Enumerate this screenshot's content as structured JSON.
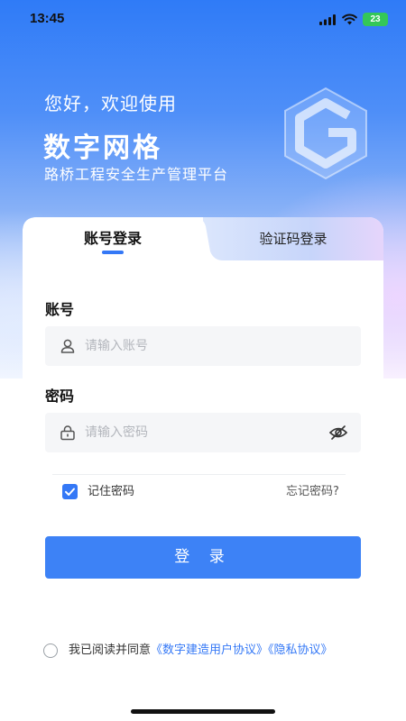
{
  "status_bar": {
    "time": "13:45",
    "battery": "23"
  },
  "hero": {
    "greeting": "您好，欢迎使用",
    "app_name": "数字网格",
    "subtitle": "路桥工程安全生产管理平台"
  },
  "tabs": [
    {
      "label": "账号登录",
      "active": true
    },
    {
      "label": "验证码登录",
      "active": false
    }
  ],
  "form": {
    "account_label": "账号",
    "account_placeholder": "请输入账号",
    "account_value": "",
    "password_label": "密码",
    "password_placeholder": "请输入密码",
    "password_value": "",
    "remember_label": "记住密码",
    "remember_checked": true,
    "forgot_label": "忘记密码?",
    "login_label": "登 录"
  },
  "agreement": {
    "prefix": "我已阅读并同意",
    "user_agreement": "《数字建造用户协议》",
    "privacy_policy": "《隐私协议》",
    "checked": false
  },
  "colors": {
    "primary": "#3478f6",
    "button": "#3d82f6",
    "battery": "#34c759"
  },
  "icons": [
    "signal-icon",
    "wifi-icon",
    "battery-icon",
    "logo-mark-icon",
    "user-icon",
    "lock-icon",
    "eye-off-icon",
    "check-icon"
  ]
}
